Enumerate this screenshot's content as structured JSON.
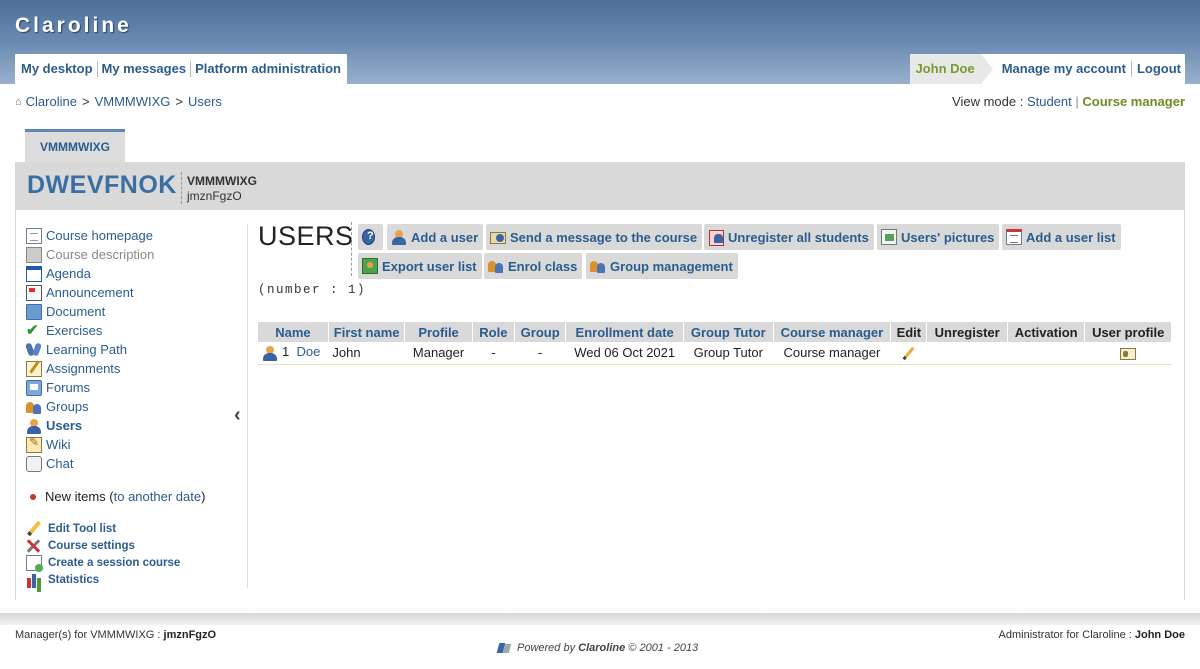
{
  "banner": {
    "brand": "Claroline",
    "nav_left": [
      "My desktop",
      "My messages",
      "Platform administration"
    ],
    "user_name": "John Doe",
    "nav_right": [
      "Manage my account",
      "Logout"
    ]
  },
  "breadcrumb": {
    "items": [
      "Claroline",
      "VMMMWIXG",
      "Users"
    ],
    "separator": ">"
  },
  "view_mode": {
    "label": "View mode :",
    "student": "Student",
    "separator": "|",
    "course_manager": "Course manager"
  },
  "course": {
    "tab": "VMMMWIXG",
    "title": "DWEVFNOK",
    "code": "VMMMWIXG",
    "manager": "jmznFgzO"
  },
  "sidebar": {
    "tools": [
      {
        "label": "Course homepage",
        "icon": "course-homepage-icon"
      },
      {
        "label": "Course description",
        "icon": "course-description-icon"
      },
      {
        "label": "Agenda",
        "icon": "agenda-icon"
      },
      {
        "label": "Announcement",
        "icon": "announcement-icon"
      },
      {
        "label": "Document",
        "icon": "document-icon"
      },
      {
        "label": "Exercises",
        "icon": "exercises-icon"
      },
      {
        "label": "Learning Path",
        "icon": "learning-path-icon"
      },
      {
        "label": "Assignments",
        "icon": "assignments-icon"
      },
      {
        "label": "Forums",
        "icon": "forums-icon"
      },
      {
        "label": "Groups",
        "icon": "groups-icon"
      },
      {
        "label": "Users",
        "icon": "users-icon"
      },
      {
        "label": "Wiki",
        "icon": "wiki-icon"
      },
      {
        "label": "Chat",
        "icon": "chat-icon"
      }
    ],
    "new_items_label": "New items (",
    "new_items_link": "to another date",
    "new_items_close": ")",
    "admin_links": [
      {
        "label": "Edit Tool list",
        "icon": "pencil-icon"
      },
      {
        "label": "Course settings",
        "icon": "tools-icon"
      },
      {
        "label": "Create a session course",
        "icon": "session-course-icon"
      },
      {
        "label": "Statistics",
        "icon": "statistics-icon"
      }
    ]
  },
  "main": {
    "heading": "USERS",
    "commands": {
      "help": "",
      "add_user": "Add a user",
      "send_message": "Send a message to the course",
      "unregister_all": "Unregister all students",
      "users_pictures": "Users' pictures",
      "add_user_list": "Add a user list",
      "export_user_list": "Export user list",
      "enrol_class": "Enrol class",
      "group_management": "Group management"
    },
    "count": "(number : 1)",
    "table": {
      "headers": [
        "Name",
        "First name",
        "Profile",
        "Role",
        "Group",
        "Enrollment date",
        "Group Tutor",
        "Course manager",
        "Edit",
        "Unregister",
        "Activation",
        "User profile"
      ],
      "rows": [
        {
          "num": "1",
          "name": "Doe",
          "first_name": "John",
          "profile": "Manager",
          "role": "-",
          "group": "-",
          "enrollment_date": "Wed 06 Oct 2021",
          "group_tutor": "Group Tutor",
          "course_manager": "Course manager",
          "unregister": "",
          "activation": ""
        }
      ]
    }
  },
  "footer": {
    "managers_label": "Manager(s) for VMMMWIXG :",
    "managers_name": "jmznFgzO",
    "admin_label": "Administrator for Claroline :",
    "admin_name": "John Doe",
    "powered_prefix": "Powered by",
    "powered_brand": "Claroline",
    "powered_suffix": "© 2001 - 2013"
  }
}
